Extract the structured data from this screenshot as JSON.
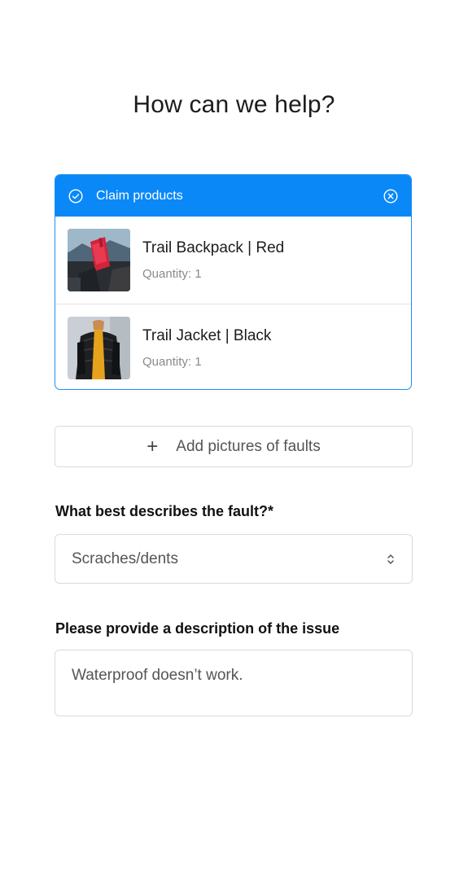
{
  "page": {
    "title": "How can we help?"
  },
  "claim": {
    "header_label": "Claim products",
    "header_icon": "check-circle-icon",
    "close_icon": "close-circle-icon",
    "accent_color": "#0a88f7",
    "products": [
      {
        "name": "Trail Backpack | Red",
        "quantity_label": "Quantity: 1",
        "image": "red-backpack-photo"
      },
      {
        "name": "Trail Jacket | Black",
        "quantity_label": "Quantity: 1",
        "image": "black-jacket-photo"
      }
    ]
  },
  "add_pictures": {
    "icon": "plus-icon",
    "label": "Add pictures of faults"
  },
  "fault": {
    "label": "What best describes the fault?*",
    "selected_value": "Scraches/dents",
    "icon": "select-chevrons-icon"
  },
  "description": {
    "label": "Please provide a description of the issue",
    "value": "Waterproof doesn’t work."
  }
}
